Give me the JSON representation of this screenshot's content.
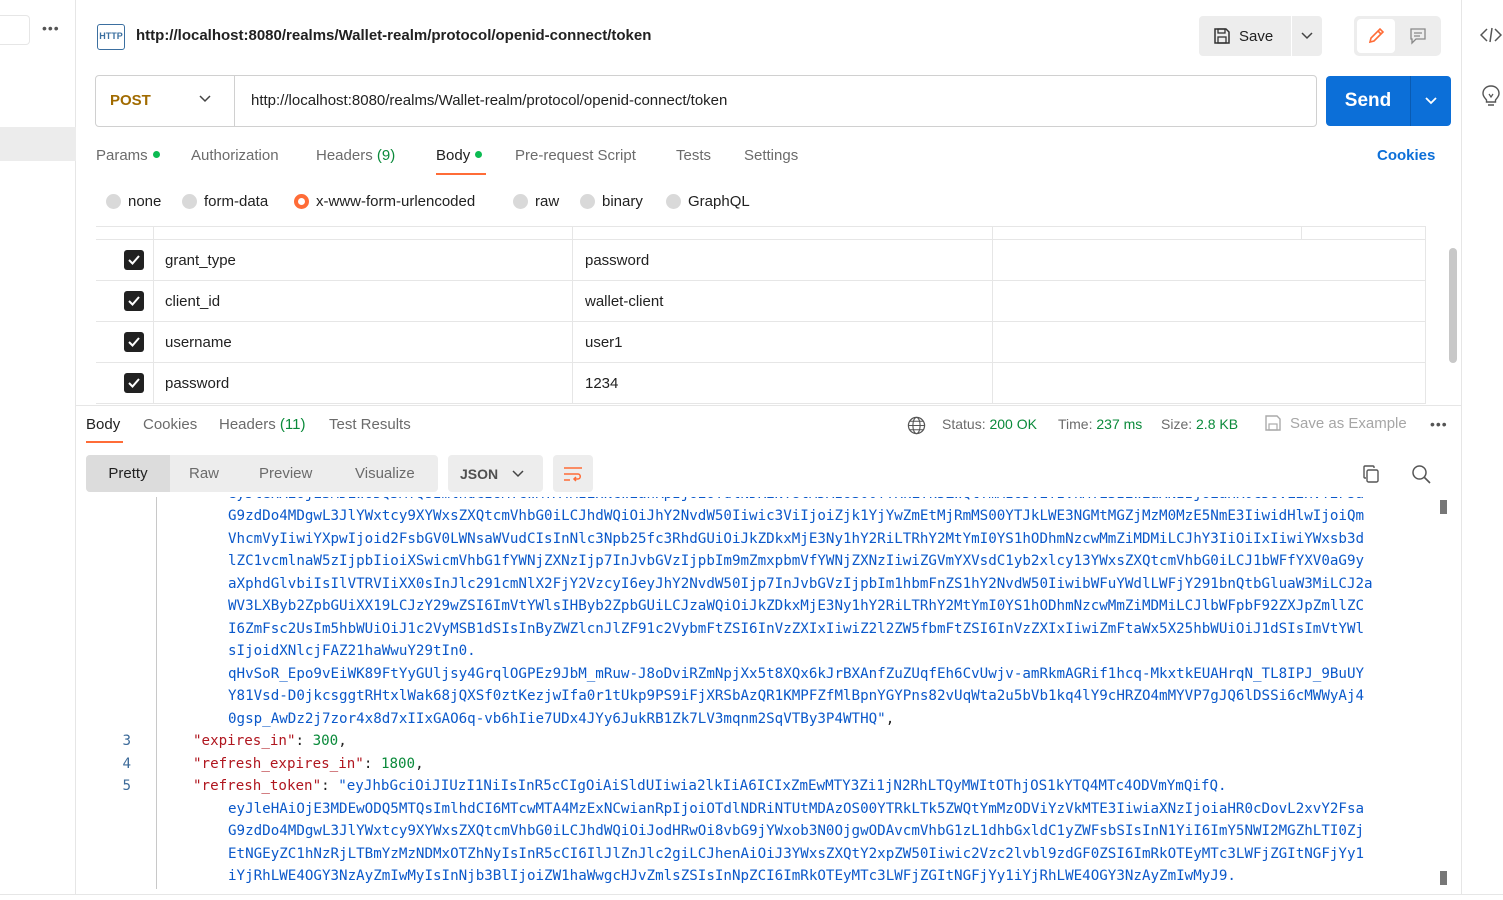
{
  "header": {
    "icon_label": "HTTP",
    "title": "http://localhost:8080/realms/Wallet-realm/protocol/openid-connect/token",
    "save_label": "Save"
  },
  "request": {
    "method": "POST",
    "url": "http://localhost:8080/realms/Wallet-realm/protocol/openid-connect/token",
    "send_label": "Send"
  },
  "request_tabs": {
    "params": "Params",
    "authorization": "Authorization",
    "headers": "Headers",
    "headers_count": "(9)",
    "body": "Body",
    "prerequest": "Pre-request Script",
    "tests": "Tests",
    "settings": "Settings",
    "cookies": "Cookies"
  },
  "body_types": [
    "none",
    "form-data",
    "x-www-form-urlencoded",
    "raw",
    "binary",
    "GraphQL"
  ],
  "body_type_selected": "x-www-form-urlencoded",
  "params": [
    {
      "key": "grant_type",
      "value": "password",
      "checked": true
    },
    {
      "key": "client_id",
      "value": "wallet-client",
      "checked": true
    },
    {
      "key": "username",
      "value": "user1",
      "checked": true
    },
    {
      "key": "password",
      "value": "1234",
      "checked": true
    }
  ],
  "response_tabs": {
    "body": "Body",
    "cookies": "Cookies",
    "headers": "Headers",
    "headers_count": "(11)",
    "test_results": "Test Results"
  },
  "response_meta": {
    "status_label": "Status:",
    "status_value": "200 OK",
    "time_label": "Time:",
    "time_value": "237 ms",
    "size_label": "Size:",
    "size_value": "2.8 KB",
    "save_example": "Save as Example"
  },
  "format_tabs": {
    "pretty": "Pretty",
    "raw": "Raw",
    "preview": "Preview",
    "visualize": "Visualize",
    "json": "JSON"
  },
  "code": {
    "access_token_lines": [
      "G9zdDo4MDgwL3JlYWxtcy9XYWxsZXQtcmVhbG0iLCJhdWQiOiJhY2NvdW50Iiwic3ViIjoiZjk1YjYwZmEtMjRmMS00YTJkLWE3NGMtMGZjMzM0MzE5NmE3IiwidHlwIjoiQm",
      "VhcmVyIiwiYXpwIjoid2FsbGV0LWNsaWVudCIsInNlc3Npb25fc3RhdGUiOiJkZDkxMjE3Ny1hY2RiLTRhY2MtYmI0YS1hODhmNzcwMmZiMDMiLCJhY3IiOiIxIiwiYWxsb3d",
      "lZC1vcmlnaW5zIjpbIioiXSwicmVhbG1fYWNjZXNzIjp7InJvbGVzIjpbIm9mZmxpbmVfYWNjZXNzIiwiZGVmYXVsdC1yb2xlcy13YWxsZXQtcmVhbG0iLCJ1bWFfYXV0aG9y",
      "aXphdGlvbiIsIlVTRVIiXX0sInJlc291cmNlX2FjY2VzcyI6eyJhY2NvdW50Ijp7InJvbGVzIjpbIm1hbmFnZS1hY2NvdW50IiwibWFuYWdlLWFjY291bnQtbGluaW3MiLCJ2a",
      "WV3LXByb2ZpbGUiXX19LCJzY29wZSI6ImVtYWlsIHByb2ZpbGUiLCJzaWQiOiJkZDkxMjE3Ny1hY2RiLTRhY2MtYmI0YS1hODhmNzcwMmZiMDMiLCJlbWFpbF92ZXJpZmllZC",
      "I6ZmFsc2UsIm5hbWUiOiJ1c2VyMSB1dSIsInByZWZlcnJlZF91c2VybmFtZSI6InVzZXIxIiwiZ2l2ZW5fbmFtZSI6InVzZXIxIiwiZmFtaWx5X25hbWUiOiJ1dSIsImVtYWl",
      "sIjoidXNlcjFAZ21haWwuY29tIn0.",
      "qHvSoR_Epo9vEiWK89FtYyGUljsy4GrqlOGPEz9JbM_mRuw-J8oDviRZmNpjXx5t8XQx6kJrBXAnfZuZUqfEh6CvUwjv-amRkmAGRif1hcq-MkxtkEUAHrqN_TL8IPJ_9BuUY",
      "Y81Vsd-D0jkcsggtRHtxlWak68jQXSf0ztKezjwIfa0r1tUkp9PS9iFjXRSbAzQR1KMPFZfMlBpnYGYPns82vUqWta2u5bVb1kq4lY9cHRZO4mMYVP7gJQ6lDSSi6cMWWyAj4",
      "0gsp_AwDz2j7zor4x8d7xIIxGAO6q-vb6hIie7UDx4JYy6JukRB1Zk7LV3mqnm2SqVTBy3P4WTHQ"
    ],
    "line3_num": "3",
    "line3_key": "\"expires_in\"",
    "line3_val": "300",
    "line4_num": "4",
    "line4_key": "\"refresh_expires_in\"",
    "line4_val": "1800",
    "line5_num": "5",
    "line5_key": "\"refresh_token\"",
    "refresh_token_first": "\"eyJhbGciOiJIUzI1NiIsInR5cCIgOiAiSldUIiwia2lkIiA6ICIxZmEwMTY3Zi1jN2RhLTQyMWItOThjOS1kYTQ4MTc4ODVmYmQifQ.",
    "refresh_token_lines": [
      "eyJleHAiOjE3MDEwODQ5MTQsImlhdCI6MTcwMTA4MzExNCwianRpIjoiOTdlNDRiNTUtMDAzOS00YTRkLTk5ZWQtYmMzODViYzVkMTE3IiwiaXNzIjoiaHR0cDovL2xvY2Fsa",
      "G9zdDo4MDgwL3JlYWxtcy9XYWxsZXQtcmVhbG0iLCJhdWQiOiJodHRwOi8vbG9jYWxob3N0OjgwODAvcmVhbG1zL1dhbGxldC1yZWFsbSIsInN1YiI6ImY5NWI2MGZhLTI0Zj",
      "EtNGEyZC1hNzRjLTBmYzMzNDMxOTZhNyIsInR5cCI6IlJlZnJlc2giLCJhenAiOiJ3YWxsZXQtY2xpZW50Iiwic2Vzc2lvbl9zdGF0ZSI6ImRkOTEyMTc3LWFjZGItNGFjYy1",
      "iYjRhLWE4OGY3NzAyZmIwMyIsInNjb3BlIjoiZW1haWwgcHJvZmlsZSIsInNpZCI6ImRkOTEyMTc3LWFjZGItNGFjYy1iYjRhLWE4OGY3NzAyZmIwMyJ9."
    ]
  },
  "colors": {
    "accent": "#ff6c37",
    "send": "#0c6fd8",
    "method": "#a16b00",
    "status_ok": "#0a8a3a"
  }
}
